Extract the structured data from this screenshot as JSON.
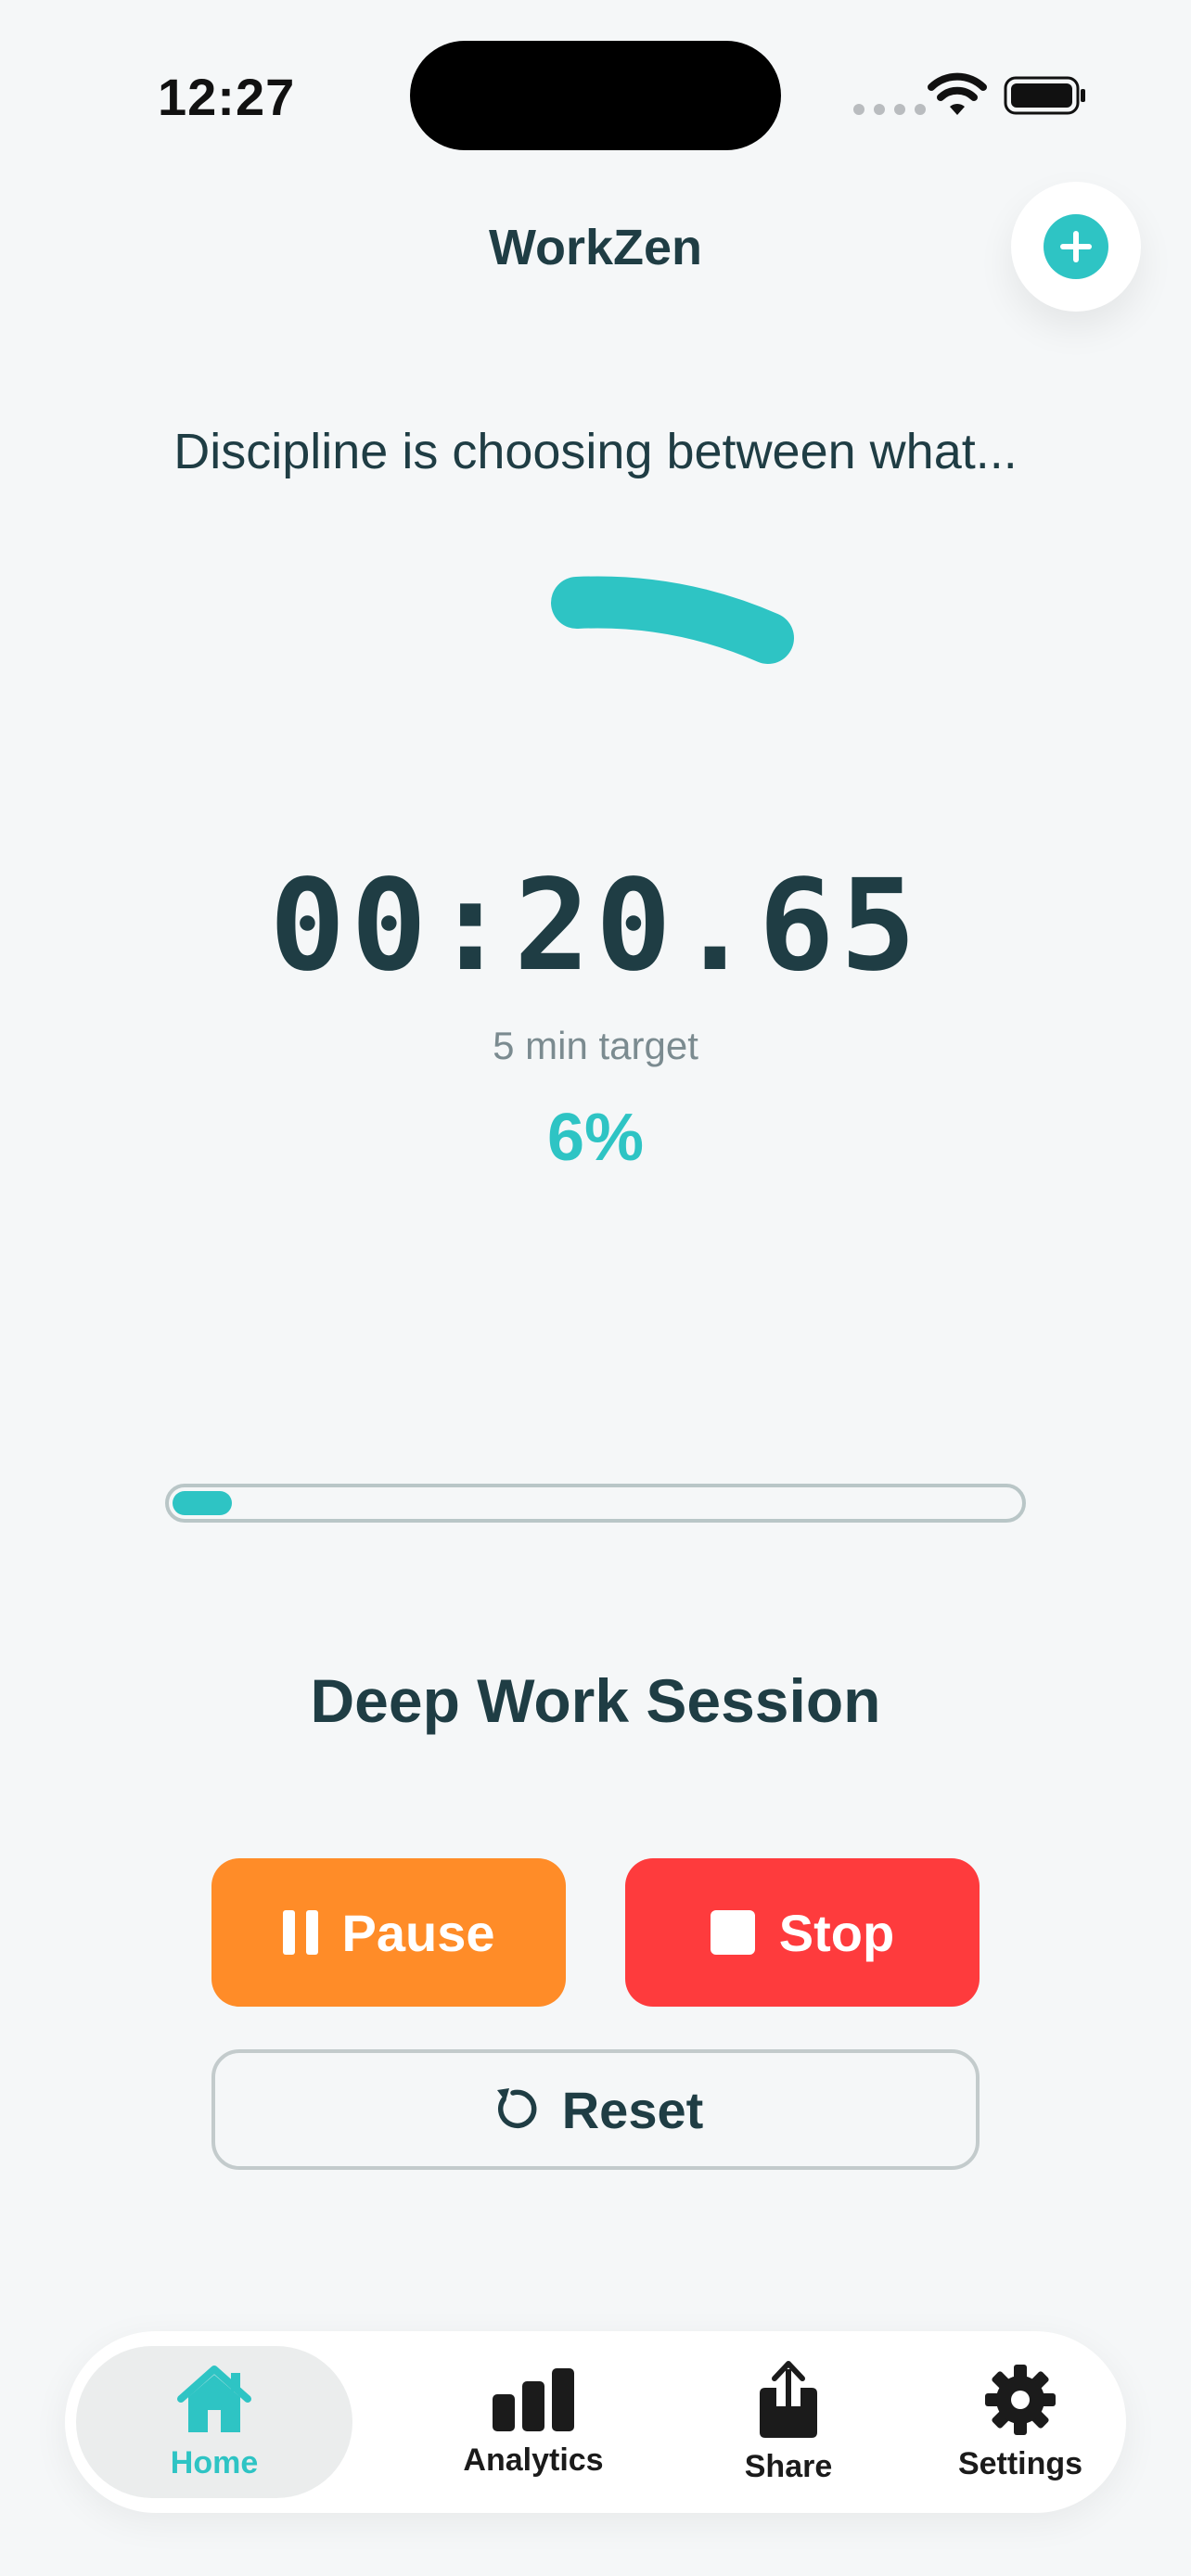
{
  "status_bar": {
    "time": "12:27"
  },
  "header": {
    "title": "WorkZen",
    "add_icon": "plus-circle-icon"
  },
  "quote": "Discipline is choosing between what...",
  "timer": {
    "elapsed": "00:20.65",
    "target_label": "5 min target",
    "percent_label": "6%",
    "progress_fraction": 0.07
  },
  "session": {
    "title": "Deep Work Session"
  },
  "controls": {
    "pause_label": "Pause",
    "stop_label": "Stop",
    "reset_label": "Reset"
  },
  "tabs": [
    {
      "label": "Home",
      "icon": "house-icon",
      "active": true
    },
    {
      "label": "Analytics",
      "icon": "bar-chart-icon",
      "active": false
    },
    {
      "label": "Share",
      "icon": "share-icon",
      "active": false
    },
    {
      "label": "Settings",
      "icon": "gear-icon",
      "active": false
    }
  ],
  "colors": {
    "accent": "#2ec4c4",
    "pause": "#ff8c28",
    "stop": "#fe3b3d",
    "text": "#1f3d44",
    "background": "#f5f7f8"
  }
}
